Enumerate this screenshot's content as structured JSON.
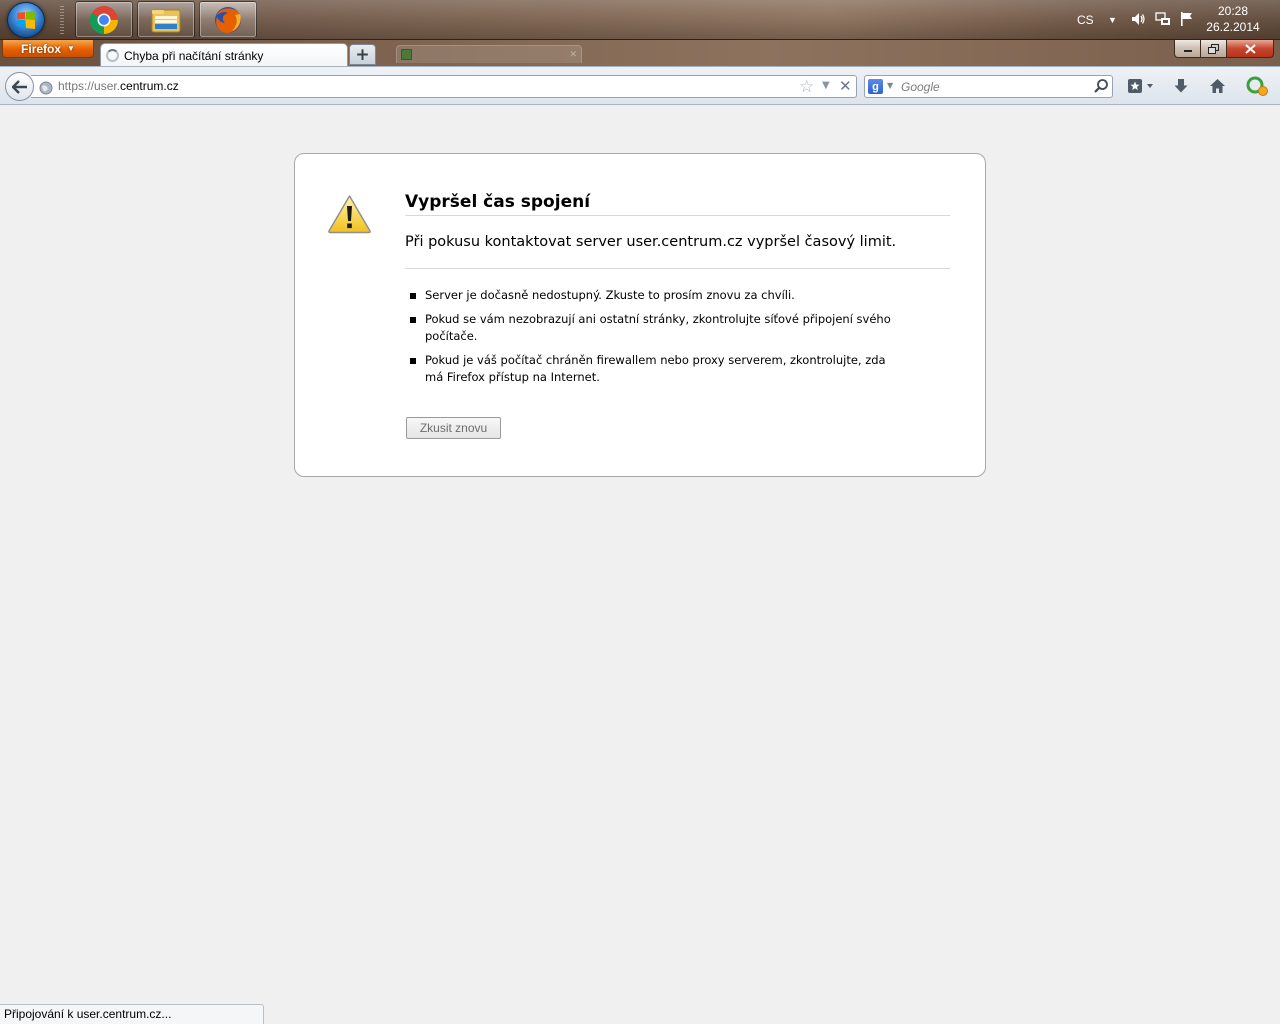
{
  "taskbar": {
    "apps": [
      {
        "name": "chrome-icon"
      },
      {
        "name": "explorer-icon"
      },
      {
        "name": "firefox-icon"
      }
    ],
    "language": "CS",
    "time": "20:28",
    "date": "26.2.2014"
  },
  "browser": {
    "menu_button_label": "Firefox",
    "active_tab_title": "Chyba při načítání stránky",
    "new_tab_label": "+",
    "url_scheme": "https://user.",
    "url_host": "centrum.cz",
    "search_placeholder": "Google",
    "search_engine_letter": "g"
  },
  "error": {
    "title": "Vypršel čas spojení",
    "short_desc": "Při pokusu kontaktovat server user.centrum.cz vypršel časový limit.",
    "items": [
      "Server je dočasně nedostupný. Zkuste to prosím znovu za chvíli.",
      "Pokud se vám nezobrazují ani ostatní stránky, zkontrolujte síťové připojení svého počítače.",
      "Pokud je váš počítač chráněn firewallem nebo proxy serverem, zkontrolujte, zda má Firefox přístup na Internet."
    ],
    "retry_label": "Zkusit znovu"
  },
  "status": {
    "text": "Připojování k user.centrum.cz..."
  },
  "colors": {
    "firefox_orange": "#e66000",
    "page_bg": "#f0f0f0",
    "warning_yellow": "#f6d33a"
  }
}
